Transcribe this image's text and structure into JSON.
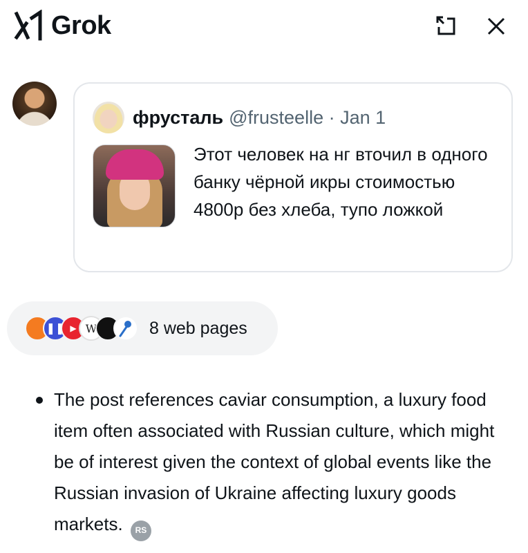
{
  "header": {
    "title": "Grok",
    "logo_icon": "grok-logo-icon",
    "expand_icon": "expand-icon",
    "close_icon": "close-icon"
  },
  "quoted_post": {
    "author_name": "фрусталь",
    "handle": "@frusteelle",
    "date": "Jan 1",
    "text": "Этот человек на нг вточил в одного банку чёрной икры стоимостью 4800р без хлеба, тупо ложкой"
  },
  "sources": {
    "label": "8 web pages",
    "icons": [
      "source-orange-icon",
      "source-blue-icon",
      "source-red-icon",
      "source-wikipedia-icon",
      "source-dark-icon",
      "source-pin-icon"
    ],
    "glyphs": {
      "wikipedia": "W",
      "blue": "❚❚",
      "red": "▶"
    }
  },
  "answer": {
    "bullets": [
      {
        "text": "The post references caviar consumption, a luxury food item often associated with Russian culture, which might be of interest given the context of global events like the Russian invasion of Ukraine affecting luxury goods markets.",
        "citation": "RS"
      }
    ]
  },
  "colors": {
    "text": "#0f1419",
    "muted": "#536471",
    "card_border": "#e3e6ea",
    "chip_bg": "#f3f4f5"
  }
}
